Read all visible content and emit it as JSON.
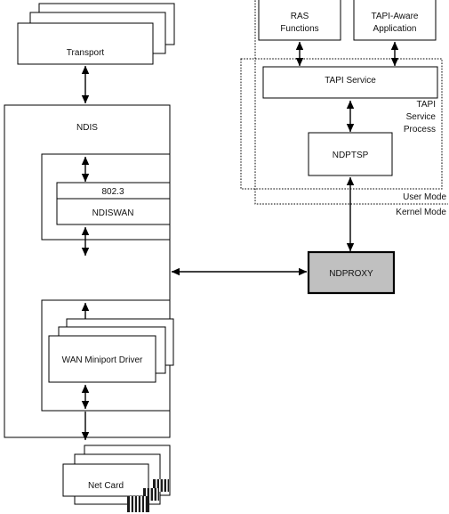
{
  "diagram": {
    "title": "NDPROXY / TAPI / NDIS architecture",
    "colors": {
      "ndproxy_fill": "#c0c0c0",
      "box_fill": "#ffffff",
      "stroke": "#000000",
      "text": "#111111"
    },
    "nodes": {
      "transport": "Transport",
      "ndis": "NDIS",
      "dot3": "802.3",
      "ndiswan": "NDISWAN",
      "wan_miniport": "WAN Miniport Driver",
      "net_card": "Net Card",
      "ras_functions_line1": "RAS",
      "ras_functions_line2": "Functions",
      "tapi_aware_line1": "TAPI-Aware",
      "tapi_aware_line2": "Application",
      "tapi_service": "TAPI Service",
      "ndptsp": "NDPTSP",
      "ndproxy": "NDPROXY"
    },
    "annotations": {
      "tapi_process_line1": "TAPI",
      "tapi_process_line2": "Service",
      "tapi_process_line3": "Process",
      "user_mode": "User Mode",
      "kernel_mode": "Kernel Mode"
    },
    "stacks": {
      "transport_count": 3,
      "wan_miniport_count": 3,
      "net_card_count": 3
    }
  }
}
